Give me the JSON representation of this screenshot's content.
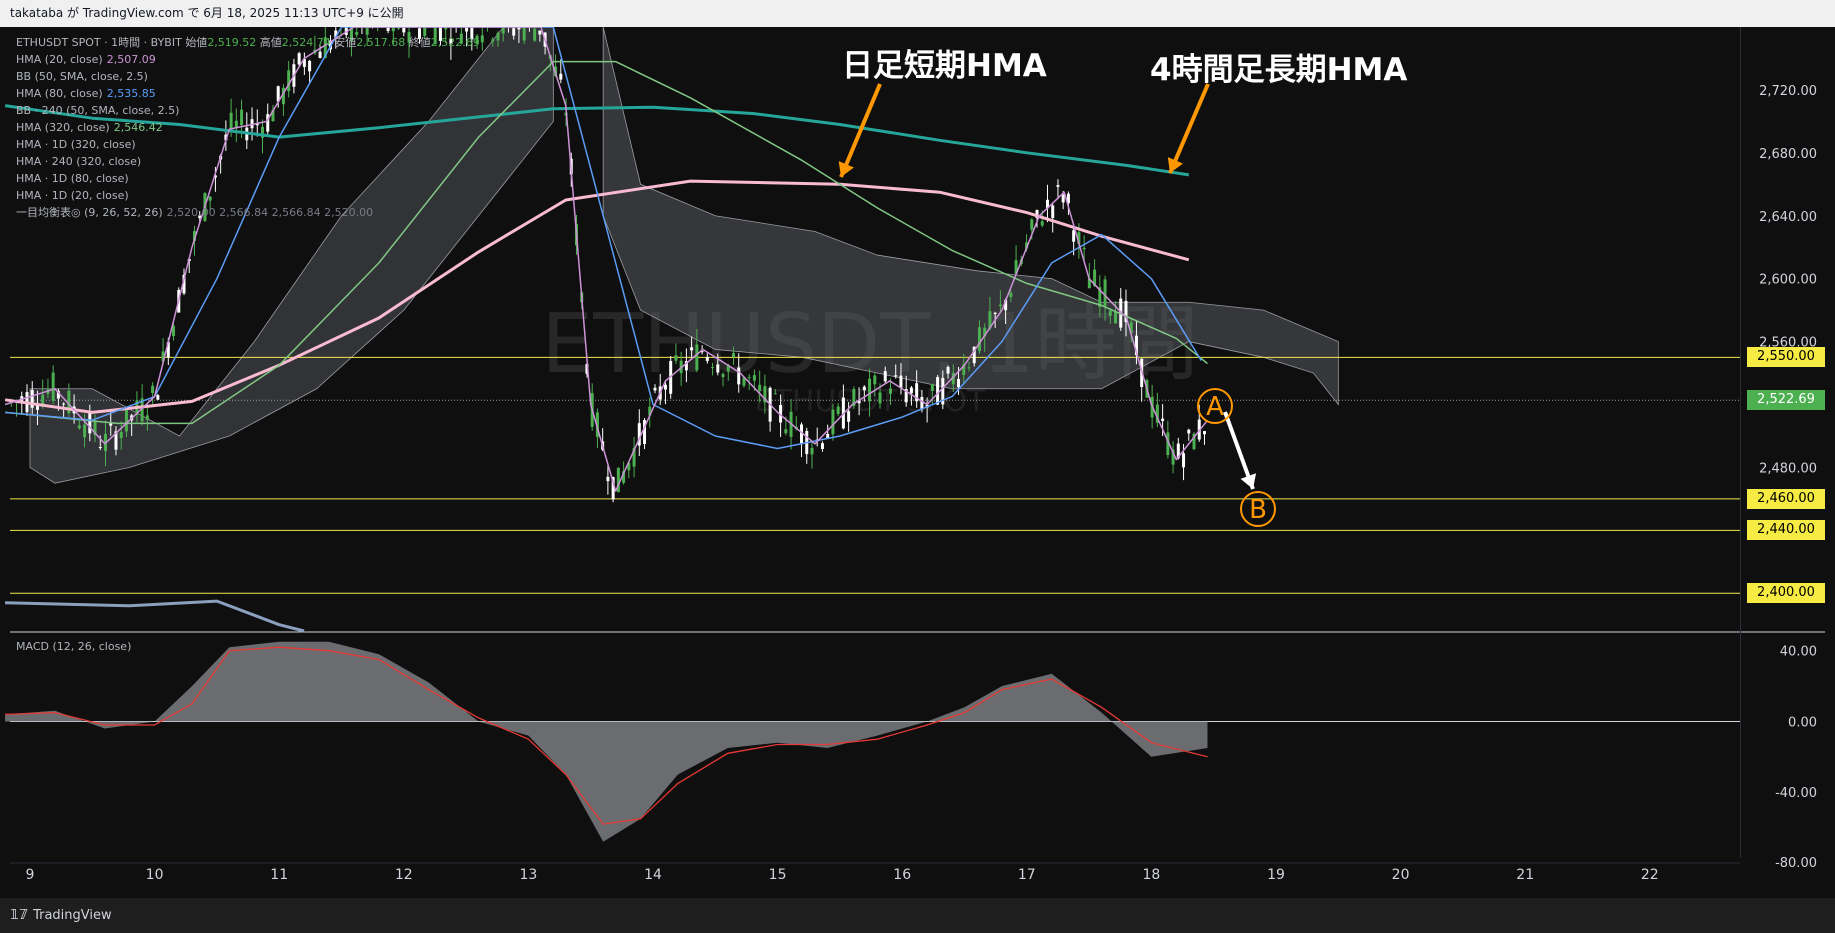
{
  "header": {
    "text": "takataba が TradingView.com で 6月 18, 2025 11:13 UTC+9 に公開"
  },
  "footer": {
    "brand": "TradingView",
    "logo_glyph": "𝟙𝟟"
  },
  "legend": {
    "symbol_line": {
      "symbol": "ETHUSDT SPOT · 1時間 · BYBIT",
      "open_label": "始値",
      "open": "2,519.52",
      "high_label": "高値",
      "high": "2,524.74",
      "low_label": "安値",
      "low": "2,517.68",
      "close_label": "終値",
      "close": "2,522.69"
    },
    "rows": [
      {
        "label": "HMA (20, close)",
        "value": "2,507.09",
        "color": "#ce93d8"
      },
      {
        "label": "BB (50, SMA, close, 2.5)",
        "value": "",
        "color": "#b2b5be"
      },
      {
        "label": "HMA (80, close)",
        "value": "2,535.85",
        "color": "#5b9cf6"
      },
      {
        "label": "BB · 240 (50, SMA, close, 2.5)",
        "value": "",
        "color": "#b2b5be"
      },
      {
        "label": "HMA (320, close)",
        "value": "2,546.42",
        "color": "#81c784"
      },
      {
        "label": "HMA · 1D (320, close)",
        "value": "",
        "color": "#b2b5be"
      },
      {
        "label": "HMA · 240 (320, close)",
        "value": "",
        "color": "#b2b5be"
      },
      {
        "label": "HMA · 1D (80, close)",
        "value": "",
        "color": "#b2b5be"
      },
      {
        "label": "HMA · 1D (20, close)",
        "value": "",
        "color": "#b2b5be"
      },
      {
        "label": "一目均衡表◎ (9, 26, 52, 26)",
        "value": "2,520.00  2,566.84  2,566.84  2,520.00",
        "color": "#787b86"
      }
    ]
  },
  "watermark": {
    "title": "ETHUSDT, 1時間",
    "subtitle": "ETHUSDT SPOT"
  },
  "annotations": {
    "daily_hma": "日足短期HMA",
    "h4_hma": "4時間足長期HMA",
    "point_a": "A",
    "point_b": "B",
    "accent_color": "#ff9800"
  },
  "macd": {
    "title": "MACD (12, 26, close)"
  },
  "chart_data": {
    "type": "line",
    "title": "ETHUSDT, 1時間",
    "x_axis": {
      "ticks": [
        "9",
        "10",
        "11",
        "12",
        "13",
        "14",
        "15",
        "16",
        "17",
        "18",
        "19",
        "20",
        "21",
        "22"
      ]
    },
    "price_axis": {
      "ticks": [
        "2,720.00",
        "2,680.00",
        "2,640.00",
        "2,600.00",
        "2,560.00",
        "2,480.00"
      ],
      "ylim": [
        2376,
        2760
      ]
    },
    "current_price": {
      "value": 2522.69,
      "label": "2,522.69",
      "color": "#4caf50"
    },
    "horizontal_levels": [
      {
        "value": 2550,
        "label": "2,550.00"
      },
      {
        "value": 2460,
        "label": "2,460.00"
      },
      {
        "value": 2440,
        "label": "2,440.00"
      },
      {
        "value": 2400,
        "label": "2,400.00"
      }
    ],
    "series": [
      {
        "name": "HMA · 240 (320, close)",
        "color": "#26a69a",
        "points": [
          [
            8.8,
            2710
          ],
          [
            9.5,
            2702
          ],
          [
            10.2,
            2698
          ],
          [
            11,
            2690
          ],
          [
            11.8,
            2696
          ],
          [
            12.5,
            2702
          ],
          [
            13.2,
            2708
          ],
          [
            14,
            2709
          ],
          [
            14.8,
            2705
          ],
          [
            15.5,
            2698
          ],
          [
            16.3,
            2688
          ],
          [
            17,
            2680
          ],
          [
            17.8,
            2672
          ],
          [
            18.3,
            2666
          ]
        ]
      },
      {
        "name": "HMA · 1D (20, close)",
        "color": "#f8bbd0",
        "points": [
          [
            8.8,
            2523
          ],
          [
            9.5,
            2515
          ],
          [
            10.3,
            2522
          ],
          [
            11,
            2545
          ],
          [
            11.8,
            2575
          ],
          [
            12.6,
            2617
          ],
          [
            13.3,
            2650
          ],
          [
            14.3,
            2662
          ],
          [
            15.5,
            2660
          ],
          [
            16.3,
            2655
          ],
          [
            17,
            2642
          ],
          [
            17.6,
            2627
          ],
          [
            18.3,
            2612
          ]
        ]
      },
      {
        "name": "HMA · 1D (80, close)",
        "color": "#8ba0bf",
        "points": [
          [
            8.8,
            2394
          ],
          [
            9.8,
            2392
          ],
          [
            10.5,
            2395
          ],
          [
            11,
            2380
          ],
          [
            11.2,
            2376
          ]
        ]
      },
      {
        "name": "HMA (320, close)",
        "color": "#81c784",
        "points": [
          [
            8.8,
            2515
          ],
          [
            9.7,
            2508
          ],
          [
            10.3,
            2508
          ],
          [
            11,
            2545
          ],
          [
            11.8,
            2610
          ],
          [
            12.6,
            2690
          ],
          [
            13.2,
            2738
          ],
          [
            13.7,
            2738
          ],
          [
            14.3,
            2715
          ],
          [
            15.2,
            2675
          ],
          [
            15.8,
            2645
          ],
          [
            16.4,
            2618
          ],
          [
            17.0,
            2597
          ],
          [
            17.6,
            2583
          ],
          [
            18.2,
            2562
          ],
          [
            18.45,
            2546
          ]
        ]
      },
      {
        "name": "HMA (80, close)",
        "color": "#5b9cf6",
        "points": [
          [
            8.8,
            2515
          ],
          [
            9.5,
            2510
          ],
          [
            10.0,
            2525
          ],
          [
            10.5,
            2600
          ],
          [
            11.0,
            2690
          ],
          [
            11.5,
            2760
          ],
          [
            13.2,
            2760
          ],
          [
            13.6,
            2640
          ],
          [
            14.0,
            2520
          ],
          [
            14.5,
            2500
          ],
          [
            15.0,
            2492
          ],
          [
            15.5,
            2500
          ],
          [
            16.0,
            2512
          ],
          [
            16.4,
            2525
          ],
          [
            16.8,
            2560
          ],
          [
            17.2,
            2610
          ],
          [
            17.6,
            2628
          ],
          [
            18.0,
            2600
          ],
          [
            18.4,
            2548
          ]
        ]
      },
      {
        "name": "HMA (20, close)",
        "color": "#ce93d8",
        "points": [
          [
            8.8,
            2520
          ],
          [
            9.2,
            2530
          ],
          [
            9.6,
            2495
          ],
          [
            10.0,
            2525
          ],
          [
            10.3,
            2620
          ],
          [
            10.6,
            2695
          ],
          [
            10.9,
            2700
          ],
          [
            11.2,
            2740
          ],
          [
            11.6,
            2760
          ],
          [
            13.1,
            2760
          ],
          [
            13.3,
            2710
          ],
          [
            13.5,
            2520
          ],
          [
            13.7,
            2465
          ],
          [
            13.9,
            2500
          ],
          [
            14.1,
            2535
          ],
          [
            14.4,
            2555
          ],
          [
            14.7,
            2540
          ],
          [
            15.0,
            2515
          ],
          [
            15.3,
            2495
          ],
          [
            15.6,
            2520
          ],
          [
            15.9,
            2535
          ],
          [
            16.2,
            2520
          ],
          [
            16.5,
            2545
          ],
          [
            16.8,
            2580
          ],
          [
            17.1,
            2640
          ],
          [
            17.3,
            2655
          ],
          [
            17.5,
            2600
          ],
          [
            17.8,
            2575
          ],
          [
            18.0,
            2520
          ],
          [
            18.2,
            2485
          ],
          [
            18.45,
            2510
          ]
        ]
      }
    ],
    "macd": {
      "axis_ticks": [
        "40.00",
        "0.00",
        "-40.00",
        "-80.00"
      ],
      "ylim": [
        -80,
        50
      ],
      "histogram": [
        [
          8.8,
          4
        ],
        [
          9.2,
          6
        ],
        [
          9.6,
          -4
        ],
        [
          10.0,
          0
        ],
        [
          10.3,
          20
        ],
        [
          10.6,
          42
        ],
        [
          11.0,
          45
        ],
        [
          11.4,
          45
        ],
        [
          11.8,
          38
        ],
        [
          12.2,
          22
        ],
        [
          12.6,
          0
        ],
        [
          13.0,
          -8
        ],
        [
          13.3,
          -30
        ],
        [
          13.6,
          -68
        ],
        [
          13.9,
          -55
        ],
        [
          14.2,
          -30
        ],
        [
          14.6,
          -15
        ],
        [
          15.0,
          -12
        ],
        [
          15.4,
          -15
        ],
        [
          15.8,
          -8
        ],
        [
          16.2,
          0
        ],
        [
          16.5,
          8
        ],
        [
          16.8,
          20
        ],
        [
          17.2,
          27
        ],
        [
          17.6,
          5
        ],
        [
          18.0,
          -20
        ],
        [
          18.45,
          -15
        ]
      ],
      "signal": [
        [
          8.8,
          4
        ],
        [
          9.2,
          5
        ],
        [
          9.6,
          -2
        ],
        [
          10.0,
          -2
        ],
        [
          10.3,
          10
        ],
        [
          10.6,
          40
        ],
        [
          11.0,
          42
        ],
        [
          11.4,
          40
        ],
        [
          11.8,
          35
        ],
        [
          12.2,
          18
        ],
        [
          12.6,
          2
        ],
        [
          13.0,
          -10
        ],
        [
          13.3,
          -30
        ],
        [
          13.6,
          -58
        ],
        [
          13.9,
          -55
        ],
        [
          14.2,
          -35
        ],
        [
          14.6,
          -18
        ],
        [
          15.0,
          -13
        ],
        [
          15.4,
          -13
        ],
        [
          15.8,
          -10
        ],
        [
          16.2,
          -2
        ],
        [
          16.5,
          5
        ],
        [
          16.8,
          18
        ],
        [
          17.2,
          24
        ],
        [
          17.6,
          8
        ],
        [
          18.0,
          -12
        ],
        [
          18.45,
          -20
        ]
      ]
    }
  }
}
